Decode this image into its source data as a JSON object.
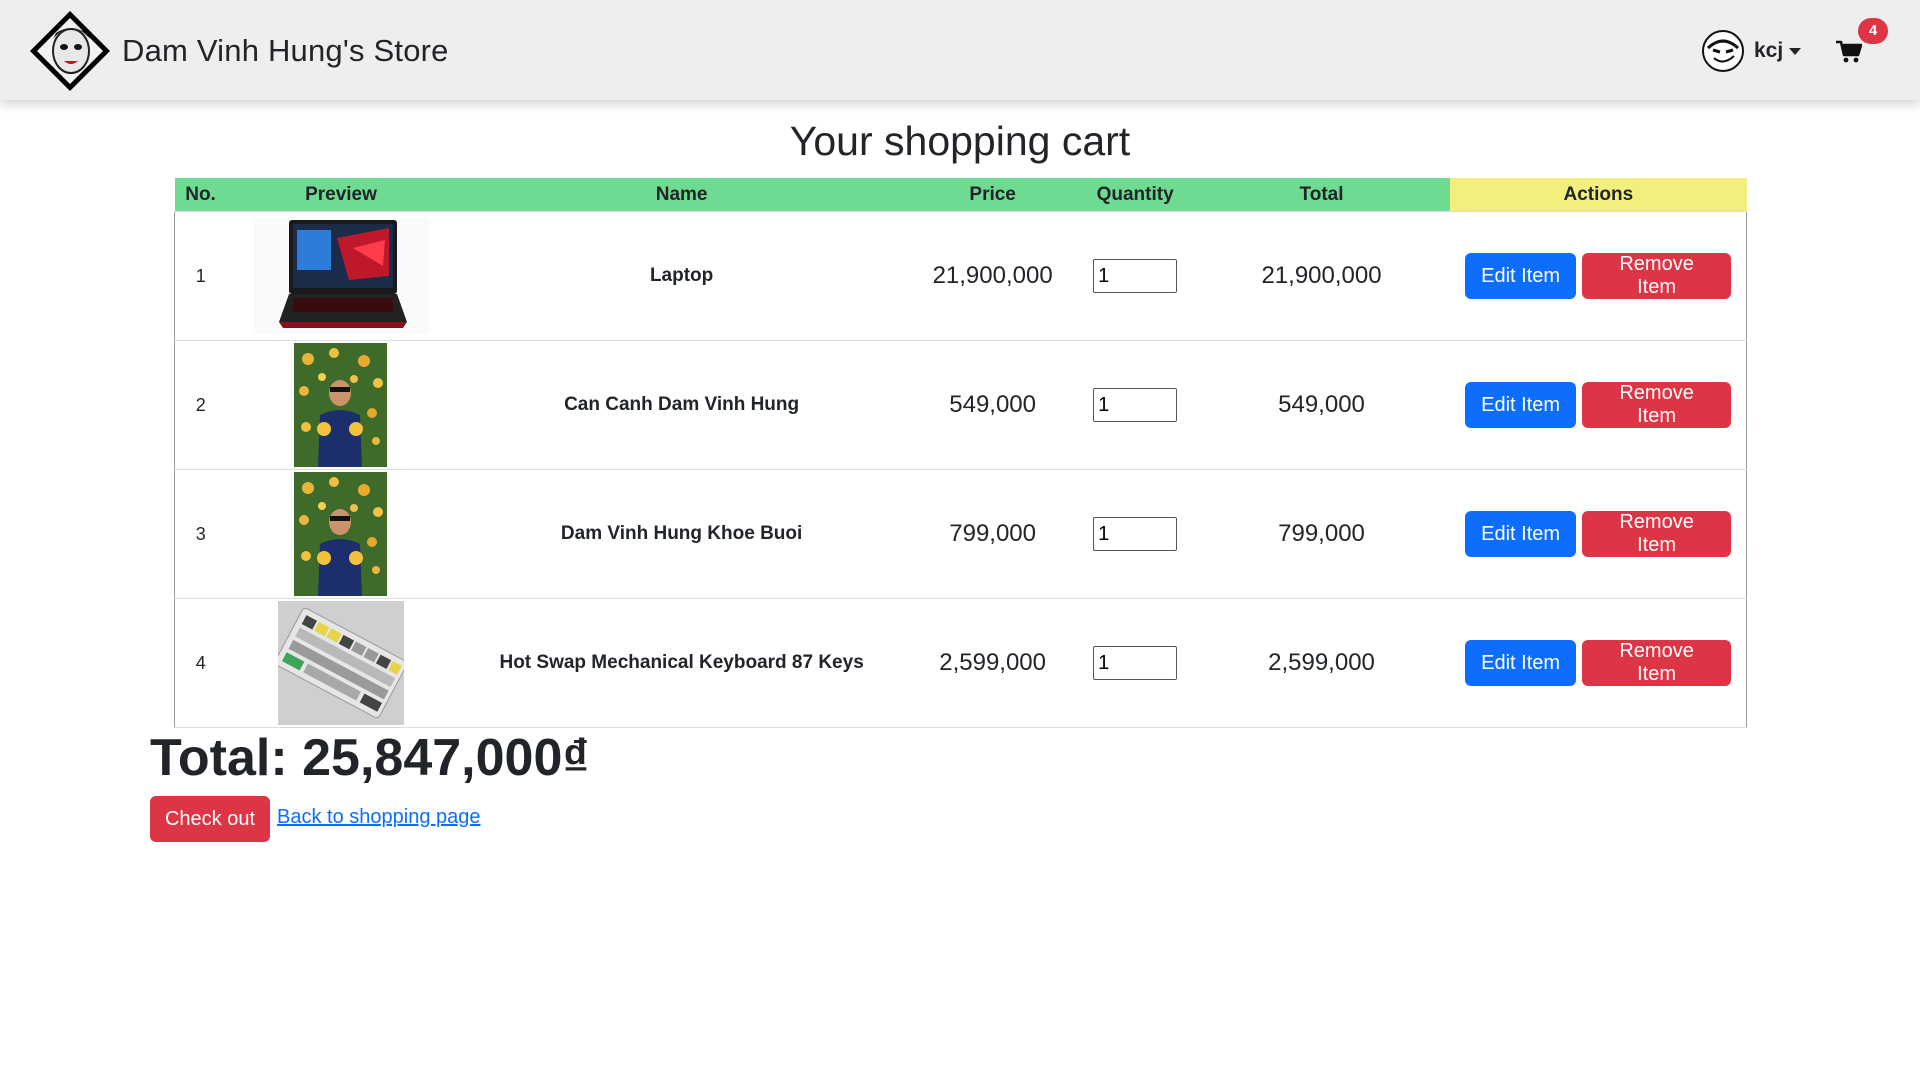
{
  "navbar": {
    "brand_name": "Dam Vinh Hung's Store",
    "username": "kcj",
    "cart_count": "4"
  },
  "page": {
    "title": "Your shopping cart"
  },
  "table": {
    "headers": {
      "no": "No.",
      "preview": "Preview",
      "name": "Name",
      "price": "Price",
      "quantity": "Quantity",
      "total": "Total",
      "actions": "Actions"
    },
    "rows": [
      {
        "no": "1",
        "name": "Laptop",
        "price": "21,900,000",
        "quantity": "1",
        "total": "21,900,000",
        "image": "laptop"
      },
      {
        "no": "2",
        "name": "Can Canh Dam Vinh Hung",
        "price": "549,000",
        "quantity": "1",
        "total": "549,000",
        "image": "person-tree"
      },
      {
        "no": "3",
        "name": "Dam Vinh Hung Khoe Buoi",
        "price": "799,000",
        "quantity": "1",
        "total": "799,000",
        "image": "person-tree"
      },
      {
        "no": "4",
        "name": "Hot Swap Mechanical Keyboard 87 Keys",
        "price": "2,599,000",
        "quantity": "1",
        "total": "2,599,000",
        "image": "keyboard"
      }
    ],
    "edit_label": "Edit Item",
    "remove_label": "Remove Item"
  },
  "summary": {
    "total_text": "Total: 25,847,000₫",
    "checkout_label": "Check out",
    "back_link_label": "Back to shopping page"
  },
  "colors": {
    "header_green": "#6fda91",
    "header_yellow": "#f2ef7c",
    "primary": "#0d6efd",
    "danger": "#dc3545",
    "navbar_bg": "#eeeeee"
  },
  "icons": [
    "logo-icon",
    "avatar-icon",
    "caret-down-icon",
    "cart-icon"
  ]
}
